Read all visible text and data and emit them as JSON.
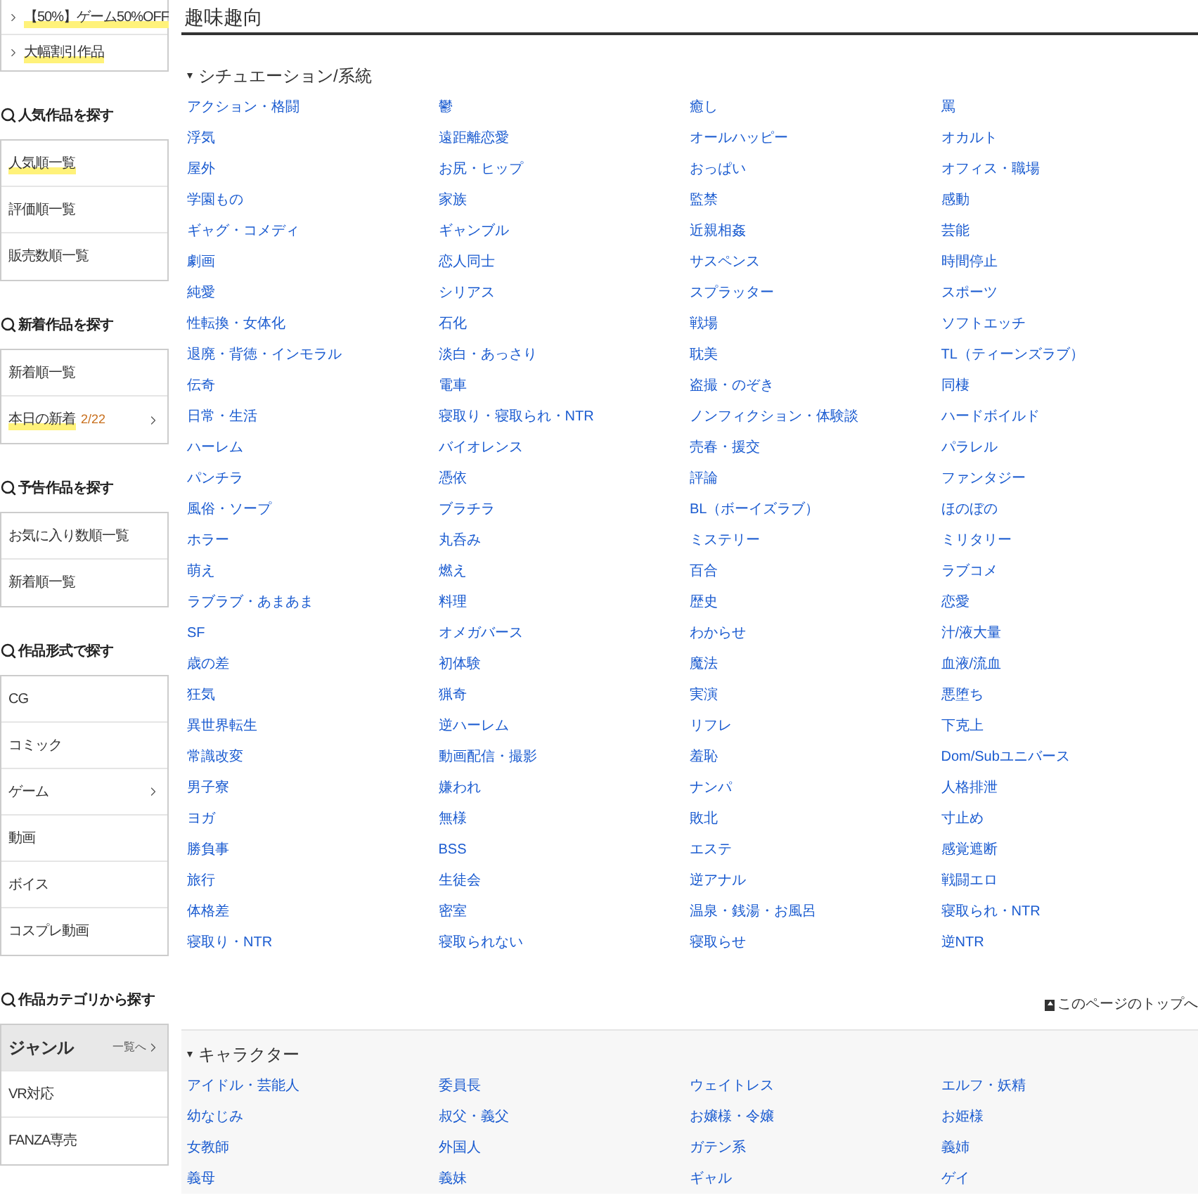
{
  "sidebar": {
    "top_items": [
      {
        "label": "【50%】ゲーム50%OFF",
        "highlighted": true
      },
      {
        "label": "大幅割引作品",
        "highlighted": true
      }
    ],
    "sections": [
      {
        "title": "人気作品を探す",
        "items": [
          {
            "label": "人気順一覧",
            "highlighted": true,
            "has_submenu": false,
            "selected": false
          },
          {
            "label": "評価順一覧",
            "highlighted": false,
            "has_submenu": false,
            "selected": false
          },
          {
            "label": "販売数順一覧",
            "highlighted": false,
            "has_submenu": false,
            "selected": false
          }
        ]
      },
      {
        "title": "新着作品を探す",
        "items": [
          {
            "label": "新着順一覧",
            "highlighted": false,
            "has_submenu": false,
            "selected": false
          },
          {
            "label": "本日の新着",
            "badge": "2/22",
            "highlighted": true,
            "has_submenu": true,
            "selected": false
          }
        ]
      },
      {
        "title": "予告作品を探す",
        "items": [
          {
            "label": "お気に入り数順一覧",
            "highlighted": false,
            "has_submenu": false,
            "selected": false
          },
          {
            "label": "新着順一覧",
            "highlighted": false,
            "has_submenu": false,
            "selected": false
          }
        ]
      },
      {
        "title": "作品形式で探す",
        "items": [
          {
            "label": "CG",
            "highlighted": false,
            "has_submenu": false,
            "selected": false
          },
          {
            "label": "コミック",
            "highlighted": false,
            "has_submenu": false,
            "selected": false
          },
          {
            "label": "ゲーム",
            "highlighted": false,
            "has_submenu": true,
            "selected": false
          },
          {
            "label": "動画",
            "highlighted": false,
            "has_submenu": false,
            "selected": false
          },
          {
            "label": "ボイス",
            "highlighted": false,
            "has_submenu": false,
            "selected": false
          },
          {
            "label": "コスプレ動画",
            "highlighted": false,
            "has_submenu": false,
            "selected": false
          }
        ]
      },
      {
        "title": "作品カテゴリから探す",
        "items": [
          {
            "label": "ジャンル",
            "link": "一覧へ",
            "highlighted": false,
            "has_submenu": true,
            "selected": true
          },
          {
            "label": "VR対応",
            "highlighted": false,
            "has_submenu": false,
            "selected": false
          },
          {
            "label": "FANZA専売",
            "highlighted": false,
            "has_submenu": false,
            "selected": false
          }
        ]
      }
    ]
  },
  "main": {
    "title": "趣味趣向",
    "sections": [
      {
        "title": "シチュエーション/系統",
        "items": [
          "アクション・格闘",
          "鬱",
          "癒し",
          "罵",
          "浮気",
          "遠距離恋愛",
          "オールハッピー",
          "オカルト",
          "屋外",
          "お尻・ヒップ",
          "おっぱい",
          "オフィス・職場",
          "学園もの",
          "家族",
          "監禁",
          "感動",
          "ギャグ・コメディ",
          "ギャンブル",
          "近親相姦",
          "芸能",
          "劇画",
          "恋人同士",
          "サスペンス",
          "時間停止",
          "純愛",
          "シリアス",
          "スプラッター",
          "スポーツ",
          "性転換・女体化",
          "石化",
          "戦場",
          "ソフトエッチ",
          "退廃・背徳・インモラル",
          "淡白・あっさり",
          "耽美",
          "TL（ティーンズラブ）",
          "伝奇",
          "電車",
          "盗撮・のぞき",
          "同棲",
          "日常・生活",
          "寝取り・寝取られ・NTR",
          "ノンフィクション・体験談",
          "ハードボイルド",
          "ハーレム",
          "バイオレンス",
          "売春・援交",
          "パラレル",
          "パンチラ",
          "憑依",
          "評論",
          "ファンタジー",
          "風俗・ソープ",
          "ブラチラ",
          "BL（ボーイズラブ）",
          "ほのぼの",
          "ホラー",
          "丸呑み",
          "ミステリー",
          "ミリタリー",
          "萌え",
          "燃え",
          "百合",
          "ラブコメ",
          "ラブラブ・あまあま",
          "料理",
          "歴史",
          "恋愛",
          "SF",
          "オメガバース",
          "わからせ",
          "汁/液大量",
          "歳の差",
          "初体験",
          "魔法",
          "血液/流血",
          "狂気",
          "猟奇",
          "実演",
          "悪堕ち",
          "異世界転生",
          "逆ハーレム",
          "リフレ",
          "下克上",
          "常識改変",
          "動画配信・撮影",
          "羞恥",
          "Dom/Subユニバース",
          "男子寮",
          "嫌われ",
          "ナンパ",
          "人格排泄",
          "ヨガ",
          "無様",
          "敗北",
          "寸止め",
          "勝負事",
          "BSS",
          "エステ",
          "感覚遮断",
          "旅行",
          "生徒会",
          "逆アナル",
          "戦闘エロ",
          "体格差",
          "密室",
          "温泉・銭湯・お風呂",
          "寝取られ・NTR",
          "寝取り・NTR",
          "寝取られない",
          "寝取らせ",
          "逆NTR"
        ],
        "page_top_link": "このページのトップへ"
      },
      {
        "title": "キャラクター",
        "items": [
          "アイドル・芸能人",
          "委員長",
          "ウェイトレス",
          "エルフ・妖精",
          "幼なじみ",
          "叔父・義父",
          "お嬢様・令嬢",
          "お姫様",
          "女教師",
          "外国人",
          "ガテン系",
          "義姉",
          "義母",
          "義妹",
          "ギャル",
          "ゲイ"
        ]
      }
    ]
  }
}
